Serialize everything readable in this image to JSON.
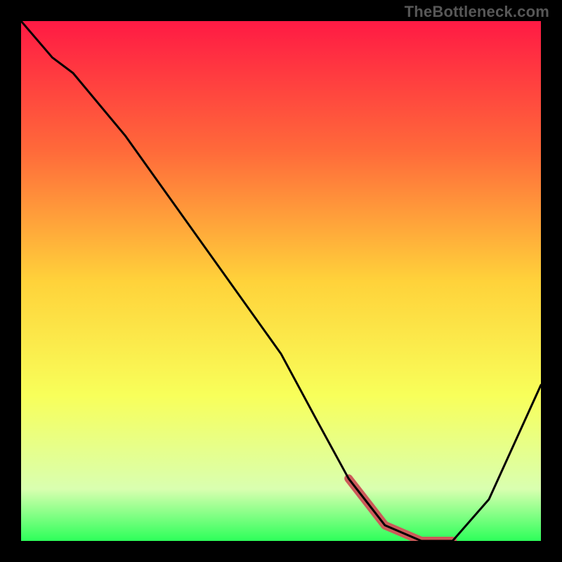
{
  "watermark": "TheBottleneck.com",
  "chart_data": {
    "type": "line",
    "title": "",
    "xlabel": "",
    "ylabel": "",
    "xlim": [
      0,
      100
    ],
    "ylim": [
      0,
      100
    ],
    "grid": false,
    "legend": false,
    "gradient": {
      "stops": [
        {
          "offset": 0,
          "color": "#ff1a44"
        },
        {
          "offset": 25,
          "color": "#ff6a3a"
        },
        {
          "offset": 50,
          "color": "#ffd23a"
        },
        {
          "offset": 72,
          "color": "#f8ff5a"
        },
        {
          "offset": 90,
          "color": "#d9ffb0"
        },
        {
          "offset": 100,
          "color": "#2dff5a"
        }
      ]
    },
    "series": [
      {
        "name": "bottleneck-curve",
        "role": "main",
        "color": "#000000",
        "x": [
          0,
          6,
          10,
          20,
          30,
          40,
          50,
          57,
          63,
          70,
          77,
          83,
          90,
          100
        ],
        "y": [
          100,
          93,
          90,
          78,
          64,
          50,
          36,
          23,
          12,
          3,
          0,
          0,
          8,
          30
        ]
      },
      {
        "name": "optimal-zone",
        "role": "highlight",
        "color": "#cc5a5a",
        "x": [
          63,
          70,
          77,
          83
        ],
        "y": [
          12,
          3,
          0,
          0
        ]
      }
    ],
    "annotations": []
  }
}
